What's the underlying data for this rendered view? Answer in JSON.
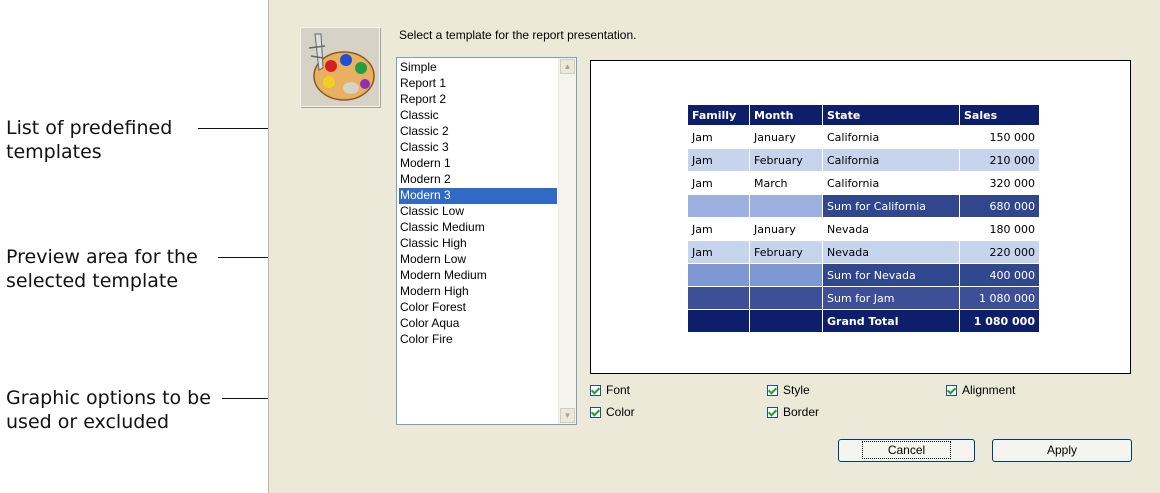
{
  "annotations": [
    {
      "line1": "List of predefined",
      "line2": "templates"
    },
    {
      "line1": "Preview area for the",
      "line2": "selected template"
    },
    {
      "line1": "Graphic options to be",
      "line2": "used or excluded"
    }
  ],
  "dialog": {
    "prompt": "Select a template for the report presentation.",
    "icon": "palette-icon"
  },
  "templates": {
    "items": [
      "Simple",
      "Report 1",
      "Report 2",
      "Classic",
      "Classic 2",
      "Classic 3",
      "Modern 1",
      "Modern 2",
      "Modern 3",
      "Classic Low",
      "Classic Medium",
      "Classic High",
      "Modern Low",
      "Modern Medium",
      "Modern High",
      "Color Forest",
      "Color Aqua",
      "Color Fire"
    ],
    "selected": "Modern 3"
  },
  "preview": {
    "headers": [
      "Familly",
      "Month",
      "State",
      "Sales"
    ],
    "rows": [
      [
        "Jam",
        "January",
        "California",
        "150 000"
      ],
      [
        "Jam",
        "February",
        "California",
        "210 000"
      ],
      [
        "Jam",
        "March",
        "California",
        "320 000"
      ],
      [
        "",
        "",
        "Sum for California",
        "680 000"
      ],
      [
        "Jam",
        "January",
        "Nevada",
        "180 000"
      ],
      [
        "Jam",
        "February",
        "Nevada",
        "220 000"
      ],
      [
        "",
        "",
        "Sum for Nevada",
        "400 000"
      ],
      [
        "",
        "",
        "Sum for Jam",
        "1 080 000"
      ],
      [
        "",
        "",
        "Grand Total",
        "1 080 000"
      ]
    ]
  },
  "options": {
    "font": "Font",
    "style": "Style",
    "alignment": "Alignment",
    "color": "Color",
    "border": "Border",
    "checked": {
      "font": true,
      "style": true,
      "alignment": true,
      "color": true,
      "border": true
    }
  },
  "buttons": {
    "cancel": "Cancel",
    "apply": "Apply"
  },
  "colors": {
    "header": "#0d1f6b",
    "selection": "#316ac5",
    "dialog_bg": "#ece9d8"
  }
}
